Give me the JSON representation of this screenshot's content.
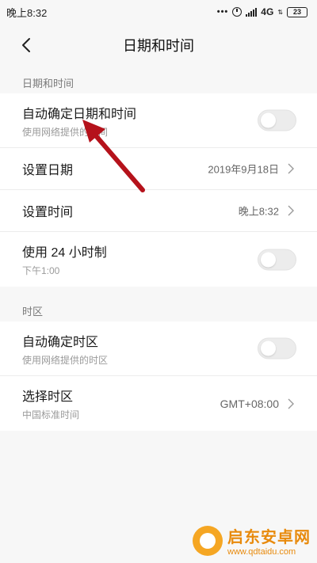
{
  "status_bar": {
    "time": "晚上8:32",
    "network": "4G",
    "battery": "23"
  },
  "header": {
    "title": "日期和时间"
  },
  "section_datetime": {
    "label": "日期和时间",
    "items": [
      {
        "title": "自动确定日期和时间",
        "subtitle": "使用网络提供的时间",
        "control": "toggle",
        "enabled": false
      },
      {
        "title": "设置日期",
        "value": "2019年9月18日",
        "control": "chevron"
      },
      {
        "title": "设置时间",
        "value": "晚上8:32",
        "control": "chevron"
      },
      {
        "title": "使用 24 小时制",
        "subtitle": "下午1:00",
        "control": "toggle",
        "enabled": false
      }
    ]
  },
  "section_timezone": {
    "label": "时区",
    "items": [
      {
        "title": "自动确定时区",
        "subtitle": "使用网络提供的时区",
        "control": "toggle",
        "enabled": false
      },
      {
        "title": "选择时区",
        "subtitle": "中国标准时间",
        "value": "GMT+08:00",
        "control": "chevron"
      }
    ]
  },
  "watermark": {
    "name": "启东安卓网",
    "url": "www.qdtaidu.com"
  },
  "colors": {
    "background": "#f7f7f7",
    "card": "#ffffff",
    "arrow": "#b5121b",
    "watermark": "#e88a0c"
  }
}
